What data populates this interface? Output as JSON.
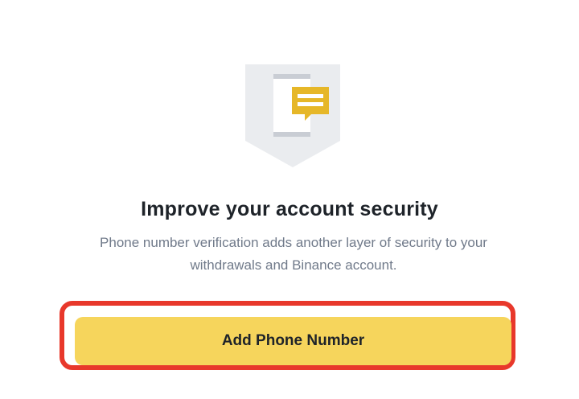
{
  "illustration": {
    "icon": "phone-message-icon",
    "colors": {
      "shield": "#eaecef",
      "phone": "#ffffff",
      "phone_bars": "#c9cdd4",
      "message": "#e6b728"
    }
  },
  "title": "Improve your account security",
  "description": "Phone number verification adds another layer of security to your withdrawals and Binance account.",
  "button": {
    "label": "Add Phone Number",
    "color": "#f6d55c",
    "highlight_color": "#e8382b"
  }
}
